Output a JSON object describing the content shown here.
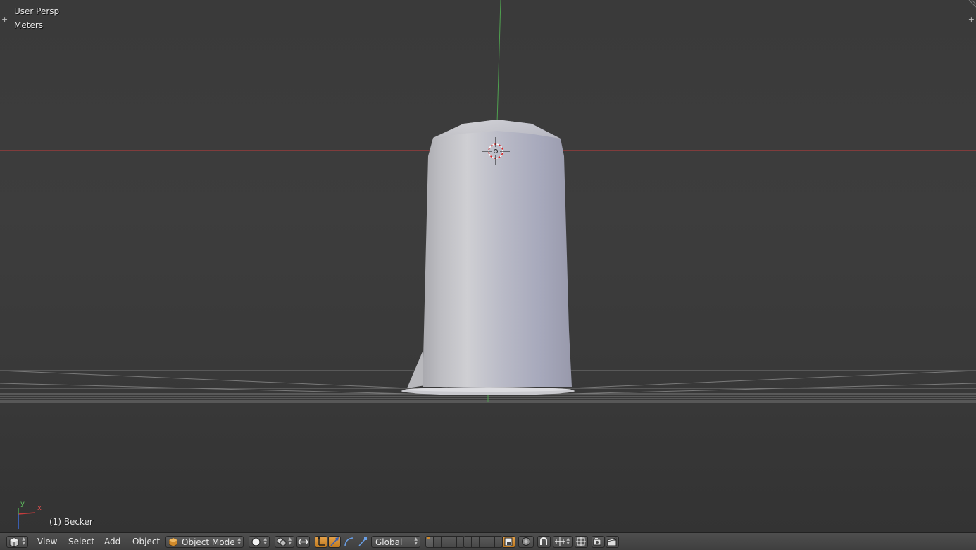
{
  "viewport": {
    "view_name": "User Persp",
    "units": "Meters",
    "object_info": "(1) Becker",
    "axes": {
      "x_label": "x",
      "y_label": "y"
    }
  },
  "colors": {
    "x_axis": "#c43c3c",
    "y_axis": "#4fa04f",
    "z_axis": "#3c6cd8",
    "active_orange": "#d08a2c"
  },
  "header": {
    "menus": [
      "View",
      "Select",
      "Add",
      "Object"
    ],
    "mode": "Object Mode",
    "orientation": "Global",
    "icons": {
      "editor_type": "3d-cube-icon",
      "shading": "solid-sphere-icon",
      "pivot": "pivot-point-icon",
      "manipulator": "manipulator-icon",
      "translate": "translate-arrow-icon",
      "rotate": "rotate-arc-icon",
      "scale": "scale-arrow-icon",
      "lock_layers": "lock-layers-icon",
      "proportional": "proportional-edit-icon",
      "snap": "snap-magnet-icon",
      "snap_element": "snap-increment-icon",
      "opengl_render": "opengl-render-icon",
      "camera": "camera-icon",
      "clapboard": "clapboard-icon"
    }
  }
}
